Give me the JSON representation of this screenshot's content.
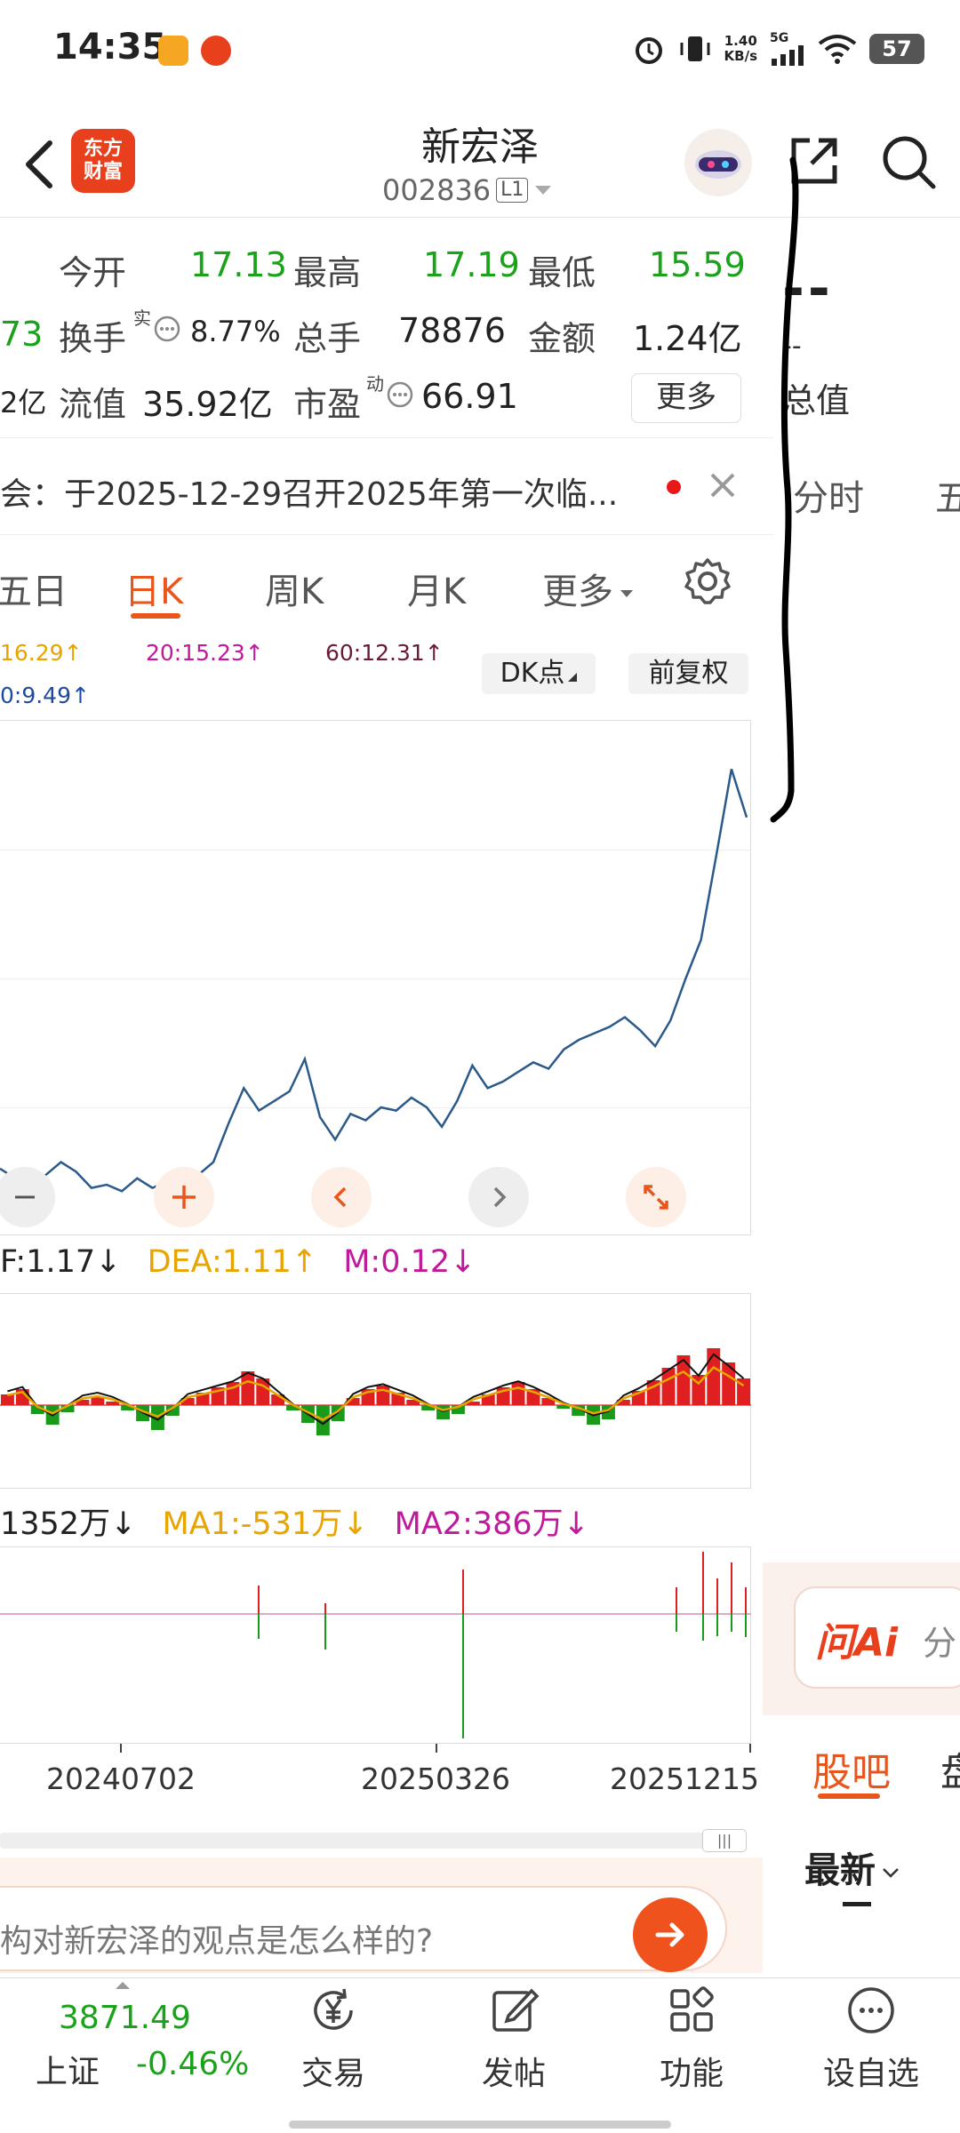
{
  "status_bar": {
    "time": "14:35",
    "net_speed_value": "1.40",
    "net_speed_unit": "KB/s",
    "net_type": "5G",
    "battery": "57"
  },
  "header": {
    "stock_name": "新宏泽",
    "stock_code": "002836",
    "level_badge": "L1",
    "brand_line1": "东方",
    "brand_line2": "财富"
  },
  "quote": {
    "open_label": "今开",
    "open_value": "17.13",
    "high_label": "最高",
    "high_value": "17.19",
    "low_label": "最低",
    "low_value": "15.59",
    "turnover_label": "换手",
    "turnover_sup": "实",
    "turnover_value": "8.77%",
    "volume_label": "总手",
    "volume_value": "78876",
    "amount_label": "金额",
    "amount_value": "1.24亿",
    "float_cap_label": "流值",
    "float_cap_value": "35.92亿",
    "pe_label": "市盈",
    "pe_sup": "动",
    "pe_value": "66.91",
    "more_label": "更多",
    "left_cut_price": "73",
    "left_cut_cap": "2亿"
  },
  "right_partial": {
    "dash": "--",
    "dash_small": "--",
    "total_value_label": "总值",
    "tab_intraday": "分时",
    "tab_next_cut": "五"
  },
  "notice": {
    "text": "会：于2025-12-29召开2025年第一次临..."
  },
  "period_tabs": {
    "five_day": "五日",
    "daily": "日K",
    "weekly": "周K",
    "monthly": "月K",
    "more": "更多"
  },
  "ma_labels": {
    "ma_a": "16.29↑",
    "ma_20": "20:15.23↑",
    "ma_60": "60:12.31↑",
    "ma_b": "0:9.49↑"
  },
  "chart_buttons": {
    "dk": "DK点",
    "adjust": "前复权"
  },
  "indicators": {
    "macd_dif": "F:1.17↓",
    "macd_dea": "DEA:1.11↑",
    "macd_m": "M:0.12↓",
    "vol_value": "1352万↓",
    "vol_ma1": "MA1:-531万↓",
    "vol_ma2": "MA2:386万↓"
  },
  "chart_data": {
    "type": "line",
    "series": [
      {
        "values": [
          7.1,
          6.8,
          6.2,
          6.9,
          7.3,
          7.0,
          6.5,
          6.6,
          6.4,
          6.8,
          6.5,
          6.7,
          6.6,
          6.9,
          7.3,
          8.5,
          9.6,
          8.9,
          9.2,
          9.5,
          10.5,
          8.7,
          8.0,
          8.8,
          8.6,
          9.0,
          8.9,
          9.3,
          9.0,
          8.4,
          9.2,
          10.3,
          9.6,
          9.8,
          10.1,
          10.4,
          10.2,
          10.8,
          11.1,
          11.3,
          11.5,
          11.8,
          11.4,
          10.9,
          11.7,
          13.0,
          14.2,
          16.8,
          19.5,
          18.0
        ]
      }
    ],
    "x_tick_labels": [
      "20240702",
      "20250326",
      "20251215"
    ],
    "grid": true
  },
  "ask": {
    "placeholder": "构对新宏泽的观点是怎么样的?"
  },
  "right_bottom": {
    "ai_logo": "问Ai",
    "ai_cut": "分",
    "guba_tab": "股吧",
    "next_tab_cut": "盘",
    "latest_filter": "最新"
  },
  "bottom_nav": {
    "index_value": "3871.49",
    "index_name": "上证",
    "index_change": "-0.46%",
    "trade": "交易",
    "post": "发帖",
    "functions": "功能",
    "add_watchlist": "设自选"
  }
}
